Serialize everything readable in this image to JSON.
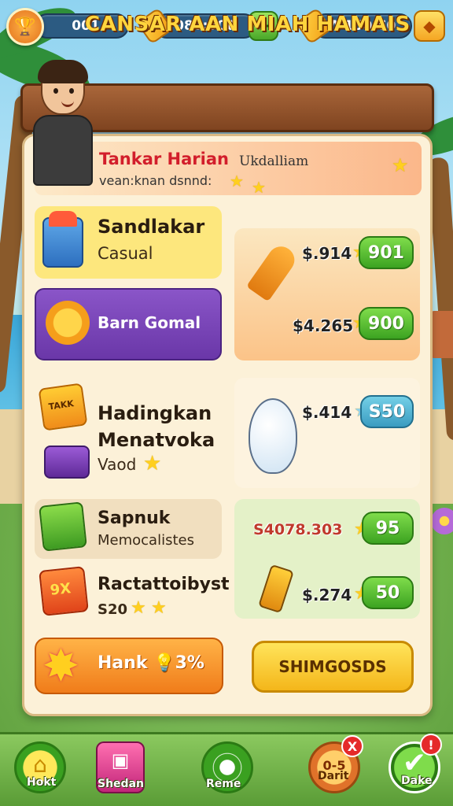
{
  "top_bar": {
    "level": "001",
    "currency1": "080:500",
    "currency2": "Λ  150.60",
    "plus": "+",
    "gem": "◆"
  },
  "banner": {
    "title": "CANSAR AAN MIAH HAMAIS"
  },
  "daily": {
    "title": "Tankar Harian",
    "subtitle": "Ukdalliam",
    "description": "vean:knan dsnnd:"
  },
  "left_items": [
    {
      "title": "Sandlakar",
      "subtitle": "Casual"
    },
    {
      "title": "Barn Gomal"
    },
    {
      "title": "Hadingkan Menatvoka",
      "subtitle": "Vaod"
    },
    {
      "title": "Sapnuk",
      "subtitle": "Memocalistes"
    },
    {
      "title": "Ractattoibyst",
      "subtitle": "S20"
    }
  ],
  "offers": [
    {
      "price": "$.914",
      "button": "901"
    },
    {
      "price": "$4.265",
      "button": "900"
    },
    {
      "price": "$.414",
      "button": "S50"
    },
    {
      "price": "S4078.303",
      "button": "95"
    },
    {
      "price": "$.274",
      "button": "50"
    }
  ],
  "cta": {
    "hank_label": "Hank 💡3%",
    "shop_label": "SHIMGOSDS"
  },
  "icon_text": {
    "box": "TAKK",
    "fire": "9X"
  },
  "bottom_nav": {
    "home": "Hokt",
    "shop": "Shedan",
    "game": "Reme",
    "daily": "Darit",
    "done": "Dake",
    "daily_icon": "0-5",
    "daily_badge": "X",
    "done_badge": "!"
  }
}
